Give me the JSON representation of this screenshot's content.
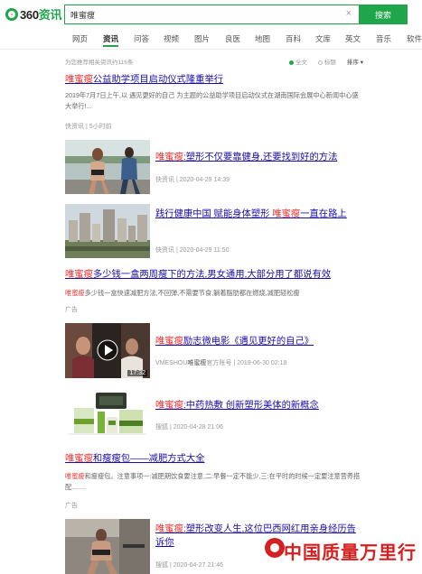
{
  "brand": {
    "logo_text_a": "360",
    "logo_text_b": "资讯"
  },
  "search": {
    "query": "唯蜜瘦",
    "button": "搜索"
  },
  "nav": [
    "网页",
    "资讯",
    "问答",
    "视频",
    "图片",
    "良医",
    "地图",
    "百科",
    "文库",
    "英文",
    "音乐",
    "软件"
  ],
  "filter": {
    "count_text": "为您推荐相关资讯约116条",
    "opt_all": "全文",
    "opt_title": "标题",
    "opt_sort": "排序"
  },
  "results": [
    {
      "title_hl": "唯蜜瘦",
      "title_rest": "公益助学项目启动仪式隆重举行",
      "desc": "2019年7月7日上午,以 遇见更好的自己 为主题的公益助学项目启动仪式在湖南国际会展中心新闻中心盛大举行!...",
      "meta": "快资讯 | 5小时前"
    },
    {
      "title_hl": "唯蜜瘦",
      "title_rest": ":塑形不仅要靠健身,还要找到好的方法",
      "meta": "快资讯 | 2020-04-29 14:39"
    },
    {
      "title_a": "践行健康中国 赋能身体塑形 ",
      "title_hl": "唯蜜瘦",
      "title_rest": "一直在路上",
      "meta": "快资讯 | 2020-04-29 11:50"
    },
    {
      "title_hl": "唯蜜瘦",
      "title_rest": "多少钱一盒两周瘦下的方法,男女通用,大部分用了都说有效",
      "desc_hl": "唯蜜瘦",
      "desc": "多少钱一盒快速减肥方法,不回弹,不需要节食,躺着脂肪都在燃烧,减肥轻松瘦",
      "meta": "广告"
    },
    {
      "title_hl": "唯蜜瘦",
      "title_rest": "励志微电影《遇见更好的自己》",
      "meta_a": "VMESHOU",
      "meta_hl": "唯蜜瘦",
      "meta_b": "官方账号 | 2019-06-30 02:18",
      "duration": "17:32"
    },
    {
      "title_hl": "唯蜜瘦",
      "title_rest": ":中药热敷 创新塑形美体的新概念",
      "meta": "搜狐 | 2020-04-28 21:06"
    },
    {
      "title_hl": "唯蜜瘦",
      "title_rest": "和瘦瘦包——减肥方式大全",
      "desc_hl": "唯蜜瘦",
      "desc": "和瘦瘦包。注意事项一:减肥期饮食要注意,二:早餐一定不能少,三:在平时的时候一定要注意营养搭配........",
      "meta": "广告"
    },
    {
      "title_hl": "唯蜜瘦",
      "title_rest": ":塑形改变人生,这位巴西网红用亲身经历告诉你",
      "meta": "搜狐 | 2020-04-27 21:46"
    }
  ],
  "watermark": "中国质量万里行",
  "colors": {
    "accent": "#1fa64a",
    "link": "#1a0dab",
    "highlight": "#e33333",
    "watermark": "#d42020"
  }
}
